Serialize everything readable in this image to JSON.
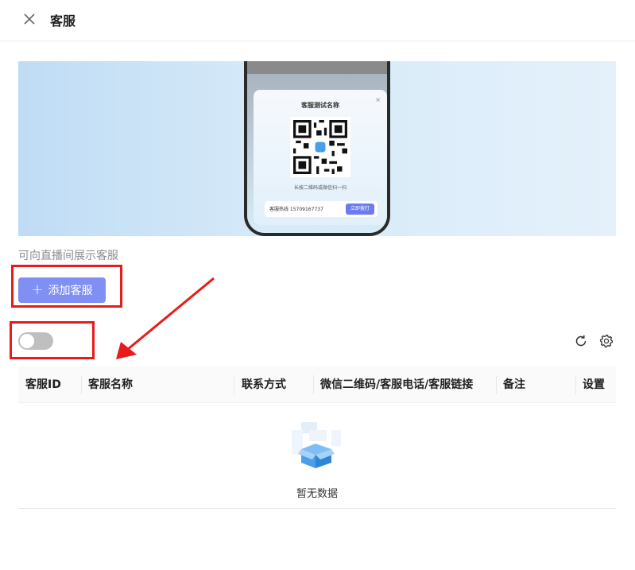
{
  "header": {
    "title": "客服",
    "close_icon": "close-icon"
  },
  "banner": {
    "popup_title": "客服测试名称",
    "popup_close": "×",
    "popup_hint": "长按二维码或微信扫一扫",
    "hotline_text": "客服热线 15709167737",
    "hotline_button": "立即拨打"
  },
  "description": "可向直播间展示客服",
  "add_button": {
    "label": "添加客服",
    "icon": "plus-icon"
  },
  "toggle": {
    "on": false
  },
  "toolbar": {
    "refresh_icon": "refresh-icon",
    "settings_icon": "gear-icon"
  },
  "table": {
    "columns": [
      "客服ID",
      "客服名称",
      "联系方式",
      "微信二维码/客服电话/客服链接",
      "备注",
      "设置"
    ],
    "rows": [],
    "empty_text": "暂无数据"
  },
  "colors": {
    "accent": "#7f8ff4",
    "annotation": "#e81a1a",
    "toggle_off": "#bfbfbf"
  }
}
